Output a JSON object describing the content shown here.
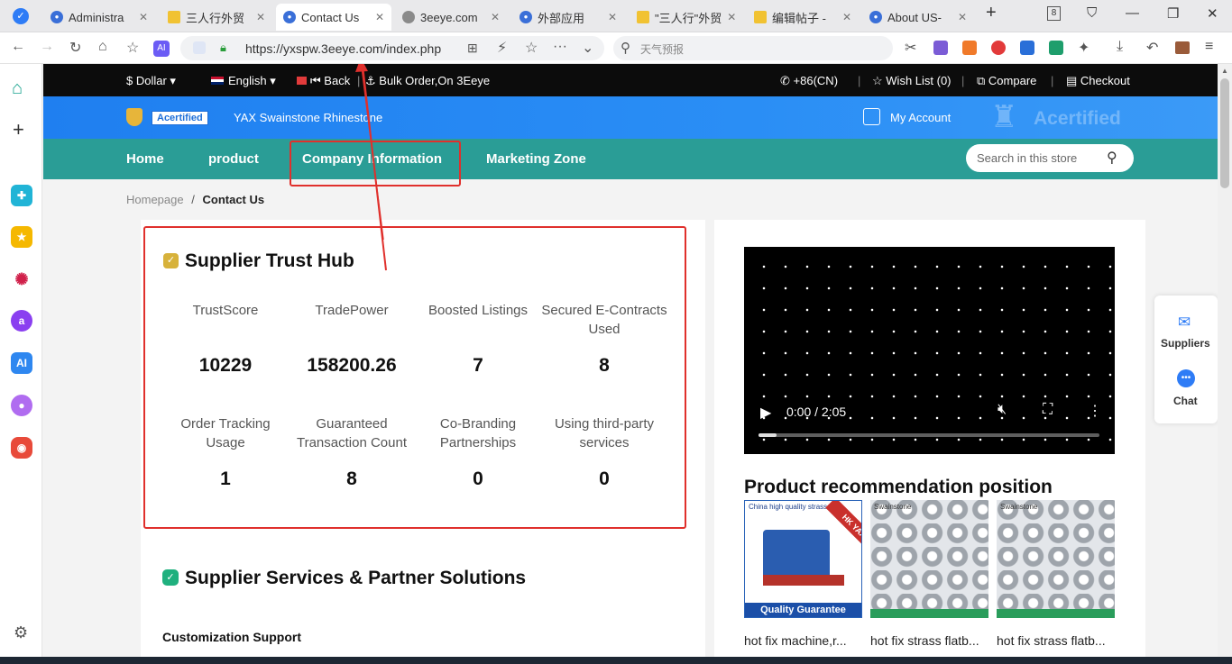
{
  "browser": {
    "tabs": [
      {
        "label": "Administra",
        "icon": "3eeye-icon"
      },
      {
        "label": "三人行外贸",
        "icon": "folder-icon"
      },
      {
        "label": "Contact Us",
        "icon": "3eeye-icon",
        "active": true
      },
      {
        "label": "3eeye.com",
        "icon": "globe-icon"
      },
      {
        "label": "外部应用",
        "icon": "3eeye-icon"
      },
      {
        "label": "\"三人行\"外贸",
        "icon": "folder-icon"
      },
      {
        "label": "编辑帖子 -",
        "icon": "folder-icon"
      },
      {
        "label": "About US-",
        "icon": "3eeye-icon"
      }
    ],
    "url": "https://yxspw.3eeye.com/index.php",
    "search_placeholder": "天气预报",
    "tab_count_badge": "8"
  },
  "topstrip": {
    "currency": "$ Dollar",
    "language": "English",
    "back": "⏮ Back",
    "bulk_order": "Bulk Order,On 3Eeye",
    "phone": "+86(CN)",
    "wishlist": "Wish List (0)",
    "compare": "Compare",
    "checkout": "Checkout"
  },
  "header": {
    "certified_badge": "Acertified",
    "store_name": "YAX Swainstone Rhinestone",
    "my_account": "My Account",
    "watermark": "Acertified"
  },
  "nav": {
    "items": [
      "Home",
      "product",
      "Company Information",
      "Marketing Zone"
    ],
    "search_placeholder": "Search in this store"
  },
  "breadcrumb": {
    "home": "Homepage",
    "sep": "/",
    "current": "Contact Us"
  },
  "trust_hub": {
    "title": "Supplier Trust Hub",
    "metrics": [
      {
        "label": "TrustScore",
        "value": "10229"
      },
      {
        "label": "TradePower",
        "value": "158200.26"
      },
      {
        "label": "Boosted Listings",
        "value": "7"
      },
      {
        "label": "Secured E-Contracts Used",
        "value": "8"
      },
      {
        "label": "Order Tracking Usage",
        "value": "1"
      },
      {
        "label": "Guaranteed Transaction Count",
        "value": "8"
      },
      {
        "label": "Co-Branding Partnerships",
        "value": "0"
      },
      {
        "label": "Using third-party services",
        "value": "0"
      }
    ]
  },
  "services": {
    "title": "Supplier Services & Partner Solutions",
    "subtitle": "Customization Support"
  },
  "video": {
    "time": "0:00 / 2:05",
    "progress": 0.0
  },
  "recommend": {
    "title": "Product recommendation position",
    "products": [
      {
        "name": "hot fix machine,r...",
        "img_top": "China high quality strass",
        "img_bottom": "Quality Guarantee",
        "ribbon": "HK YAX"
      },
      {
        "name": "hot fix strass flatb...",
        "img_top": "Swainstone",
        "img_bottom": ""
      },
      {
        "name": "hot fix strass flatb...",
        "img_top": "Swainstone",
        "img_bottom": ""
      }
    ]
  },
  "float": {
    "suppliers": "Suppliers",
    "chat": "Chat"
  },
  "colors": {
    "nav_teal": "#2a9d96",
    "header_blue": "#2a8ef5",
    "highlight_red": "#e0302c"
  }
}
